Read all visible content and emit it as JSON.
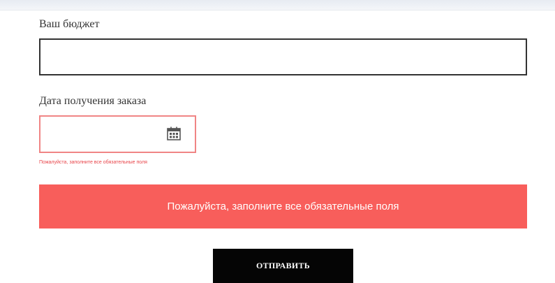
{
  "form": {
    "budget_label": "Ваш бюджет",
    "budget_value": "",
    "date_label": "Дата получения заказа",
    "date_value": "",
    "date_icon": "calendar-icon",
    "field_error": "Пожалуйста, заполните все обязательные поля",
    "form_error": "Пожалуйста, заполните все обязательные поля",
    "submit_label": "ОТПРАВИТЬ"
  },
  "colors": {
    "error_banner": "#f85e5b",
    "error_text": "#e8454a",
    "error_border": "#f08585",
    "submit_bg": "#050505",
    "input_border": "#333333"
  }
}
